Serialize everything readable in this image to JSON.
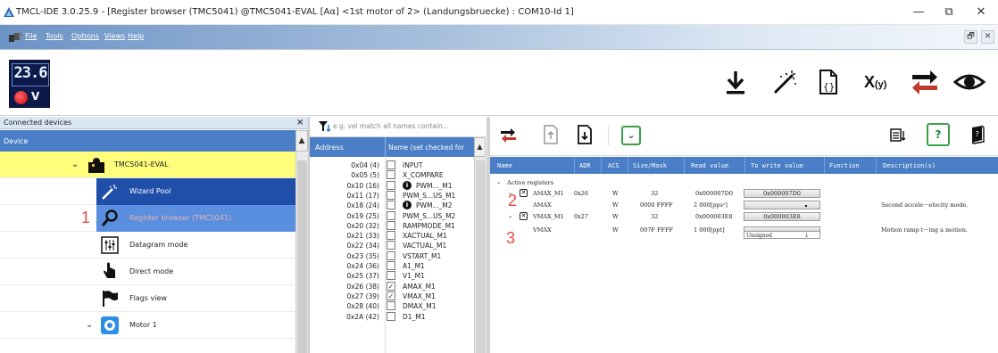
{
  "window": {
    "title": "TMCL-IDE 3.0.25.9 - [Register browser (TMC5041) @TMC5041-EVAL [Aα] <1st motor of 2> (Landungsbruecke) : COM10-Id 1]",
    "min_glyph": "—",
    "max_glyph": "⧉",
    "close_glyph": "✕"
  },
  "menu": {
    "items": [
      "File",
      "Tools",
      "Options",
      "Views",
      "Help"
    ],
    "restore_glyph": "🗗",
    "close_glyph": "✕"
  },
  "toolbar": {
    "logo_digits": "23.6",
    "logo_letter": "V",
    "icons": [
      "download-icon",
      "magic-wand-icon",
      "file-code-icon",
      "function-xy-icon",
      "swap-arrows-icon",
      "eye-icon"
    ],
    "xy_label": "X",
    "xy_sub": "(y)"
  },
  "left_panel": {
    "title": "Connected devices",
    "close_glyph": "×",
    "column": "Device",
    "tree": [
      {
        "label": "TMC5041-EVAL",
        "icon": "puzzle-icon",
        "expanded": true
      },
      {
        "label": "Wizard Pool",
        "icon": "magic-wand-icon"
      },
      {
        "label": "Register browser (TMC5041)",
        "icon": "search-icon"
      },
      {
        "label": "Datagram mode",
        "icon": "datagram-icon"
      },
      {
        "label": "Direct mode",
        "icon": "hand-pointer-icon"
      },
      {
        "label": "Flags view",
        "icon": "flag-icon"
      },
      {
        "label": "Motor 1",
        "icon": "motor-icon",
        "expanded": true
      }
    ],
    "annotation": "1"
  },
  "middle_panel": {
    "search_placeholder": "e.g. vel match all names contain...",
    "col_address": "Address",
    "col_name": "Name (set checked for",
    "rows": [
      {
        "addr": "0x04 (4)",
        "name": "INPUT",
        "checked": false,
        "info": false
      },
      {
        "addr": "0x05 (5)",
        "name": "X_COMPARE",
        "checked": false,
        "info": false
      },
      {
        "addr": "0x10 (16)",
        "name": "PWM..._M1",
        "checked": false,
        "info": true
      },
      {
        "addr": "0x11 (17)",
        "name": "PWM_S...US_M1",
        "checked": false,
        "info": false
      },
      {
        "addr": "0x18 (24)",
        "name": "PWM..._M2",
        "checked": false,
        "info": true
      },
      {
        "addr": "0x19 (25)",
        "name": "PWM_S...US_M2",
        "checked": false,
        "info": false
      },
      {
        "addr": "0x20 (32)",
        "name": "RAMPMODE_M1",
        "checked": false,
        "info": false
      },
      {
        "addr": "0x21 (33)",
        "name": "XACTUAL_M1",
        "checked": false,
        "info": false
      },
      {
        "addr": "0x22 (34)",
        "name": "VACTUAL_M1",
        "checked": false,
        "info": false
      },
      {
        "addr": "0x23 (35)",
        "name": "VSTART_M1",
        "checked": false,
        "info": false
      },
      {
        "addr": "0x24 (36)",
        "name": "A1_M1",
        "checked": false,
        "info": false
      },
      {
        "addr": "0x25 (37)",
        "name": "V1_M1",
        "checked": false,
        "info": false
      },
      {
        "addr": "0x26 (38)",
        "name": "AMAX_M1",
        "checked": true,
        "info": false
      },
      {
        "addr": "0x27 (39)",
        "name": "VMAX_M1",
        "checked": true,
        "info": false
      },
      {
        "addr": "0x28 (40)",
        "name": "DMAX_M1",
        "checked": false,
        "info": false
      },
      {
        "addr": "0x2A (42)",
        "name": "D1_M1",
        "checked": false,
        "info": false
      }
    ]
  },
  "right_panel": {
    "help_glyph": "?",
    "columns": [
      "Name",
      "ADR",
      "ACS",
      "Size/Mask",
      "Read value",
      "To write value",
      "Function",
      "Description(s)"
    ],
    "section": "Active registers",
    "registers": [
      {
        "name": "AMAX_M1",
        "adr": "0x26",
        "acs": "W",
        "size": "32",
        "read": "0x000007D0",
        "write": "0x000007D0",
        "desc": ""
      },
      {
        "name": "AMAX",
        "adr": "",
        "acs": "W",
        "size": "0000 FFFF",
        "read": "2 000[pps²]",
        "write": "",
        "desc": "Second accele···elocity mode."
      },
      {
        "name": "VMAX_M1",
        "adr": "0x27",
        "acs": "W",
        "size": "32",
        "read": "0x000003E8",
        "write": "0x000003E8",
        "desc": ""
      },
      {
        "name": "VMAX",
        "adr": "",
        "acs": "W",
        "size": "007F FFFF",
        "read": "1 000[ppt]",
        "write": "Unsigned",
        "desc": "Motion ramp t···ing a motion."
      }
    ],
    "annotation_2": "2",
    "annotation_3": "3"
  }
}
